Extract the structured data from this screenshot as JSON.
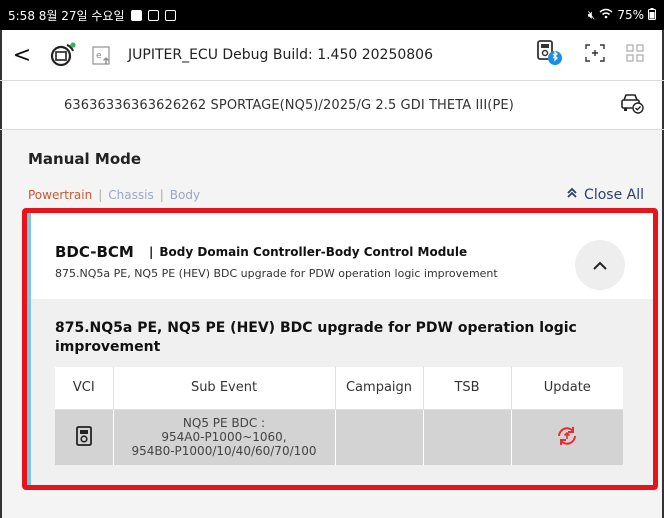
{
  "status_bar": {
    "time_date": "5:58 8월 27일 수요일",
    "battery": "75%"
  },
  "toolbar": {
    "back_label": "<",
    "title": "JUPITER_ECU Debug Build: 1.450 20250806",
    "icons": [
      "ecu-refresh-icon",
      "e-upload-icon",
      "bluetooth-vci-icon",
      "scan-focus-icon",
      "grid-icon"
    ]
  },
  "vehicle": {
    "info": "63636336363626262  SPORTAGE(NQ5)/2025/G 2.5 GDI THETA III(PE)"
  },
  "main": {
    "title": "Manual Mode",
    "tabs": [
      {
        "label": "Powertrain",
        "active": true
      },
      {
        "label": "Chassis",
        "active": false
      },
      {
        "label": "Body",
        "active": false
      }
    ],
    "tab_separator": "|",
    "close_all": "Close All"
  },
  "card": {
    "system_code": "BDC-BCM",
    "separator": "|",
    "system_name": "Body Domain Controller-Body Control Module",
    "subtitle": "875.NQ5a PE, NQ5 PE (HEV) BDC upgrade for PDW operation logic improvement",
    "event_title": "875.NQ5a PE, NQ5 PE (HEV) BDC upgrade for PDW operation logic improvement",
    "table": {
      "headers": [
        "VCI",
        "Sub Event",
        "Campaign",
        "TSB",
        "Update"
      ],
      "rows": [
        {
          "sub_event_lines": [
            "NQ5 PE BDC :",
            "954A0-P1000~1060,",
            "954B0-P1000/10/40/60/70/100"
          ],
          "campaign": "",
          "tsb": ""
        }
      ]
    }
  },
  "colors": {
    "highlight": "#e8141b",
    "accent_active_tab": "#c65a34",
    "inactive_tab": "#9aa7c4",
    "card_stripe": "#7ac7de",
    "update_icon": "#e03030",
    "close_all": "#2c3f6b"
  }
}
